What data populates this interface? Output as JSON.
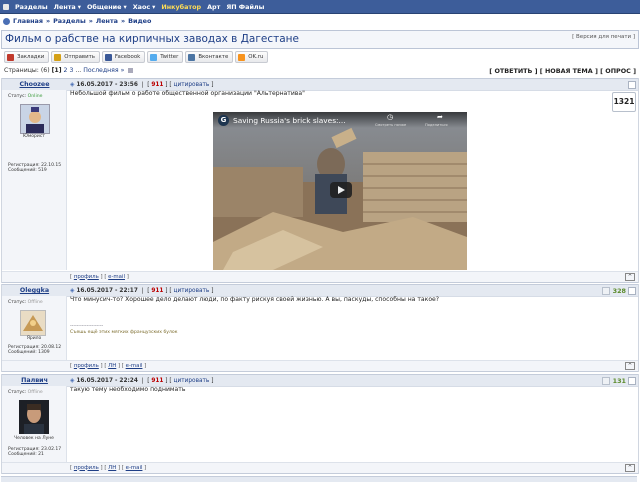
{
  "nav": {
    "items": [
      {
        "label": "Разделы",
        "dropdown": false,
        "highlight": false
      },
      {
        "label": "Лента",
        "dropdown": true,
        "highlight": false
      },
      {
        "label": "Общение",
        "dropdown": true,
        "highlight": false
      },
      {
        "label": "Хаос",
        "dropdown": true,
        "highlight": false
      },
      {
        "label": "Инкубатор",
        "dropdown": false,
        "highlight": true
      },
      {
        "label": "Арт",
        "dropdown": false,
        "highlight": false
      },
      {
        "label": "ЯП Файлы",
        "dropdown": false,
        "highlight": false
      }
    ]
  },
  "breadcrumbs": [
    "Главная",
    "Разделы",
    "Лента",
    "Видео"
  ],
  "topic": {
    "title": "Фильм о рабстве на кирпичных заводах в Дагестане",
    "print_link": "[ Версия для печати ]"
  },
  "share": {
    "buttons": [
      {
        "label": "Закладки",
        "icon": "bookmark-icon",
        "color": "#c0392b"
      },
      {
        "label": "Отправить",
        "icon": "mail-icon",
        "color": "#d4a017"
      },
      {
        "label": "Facebook",
        "icon": "facebook-icon",
        "color": "#3b5998"
      },
      {
        "label": "Twitter",
        "icon": "twitter-icon",
        "color": "#55acee"
      },
      {
        "label": "Вконтакте",
        "icon": "vk-icon",
        "color": "#4c75a3"
      },
      {
        "label": "OK.ru",
        "icon": "ok-icon",
        "color": "#f7931e"
      }
    ]
  },
  "pager": {
    "label": "Страницы:",
    "count": "(6)",
    "current": "[1]",
    "pages": [
      "2",
      "3"
    ],
    "ellipsis": "...",
    "last": "Последняя »"
  },
  "actions": {
    "reply": "[ ОТВЕТИТЬ ]",
    "new_topic": "[ НОВАЯ ТЕМА ]",
    "poll": "[ ОПРОС ]"
  },
  "posts": [
    {
      "author": "Choozee",
      "date": "16.05.2017 - 23:56",
      "num": "911",
      "quote": "цитировать",
      "rating": "1321",
      "status_label": "Статус:",
      "status": "Online",
      "caption": "Юморист",
      "reg": "Регистрация: 22.10.15",
      "msgs": "Сообщений: 519",
      "text": "Небольшой фильм о работе общественной организации \"Альтернатива\"",
      "video_title": "Saving Russia's brick slaves:...",
      "video_watch": "Смотреть позже",
      "video_share": "Поделиться",
      "footer": [
        "профиль",
        "e-mail"
      ]
    },
    {
      "author": "Oleggka",
      "date": "16.05.2017 - 22:17",
      "num": "911",
      "quote": "цитировать",
      "rating": "328",
      "status_label": "Статус:",
      "status": "Offline",
      "caption": "Ярило",
      "reg": "Регистрация: 20.08.12",
      "msgs": "Сообщений: 1309",
      "text": "Что минусич-то? Хорошее дело делают люди, по факту рискуя своей жизнью. А вы, паскуды, способны на такое?",
      "sig_line": "--------------------",
      "sig": "Съешь ещё этих мягких французских булок",
      "footer": [
        "профиль",
        "ЛН",
        "e-mail"
      ]
    },
    {
      "author": "Палвич",
      "date": "16.05.2017 - 22:24",
      "num": "911",
      "quote": "цитировать",
      "rating": "131",
      "status_label": "Статус:",
      "status": "Offline",
      "caption": "Человек на Луне",
      "reg": "Регистрация: 23.02.17",
      "msgs": "Сообщений: 21",
      "text": "такую тему необходимо поднимать",
      "footer": [
        "профиль",
        "ЛН",
        "e-mail"
      ]
    }
  ]
}
